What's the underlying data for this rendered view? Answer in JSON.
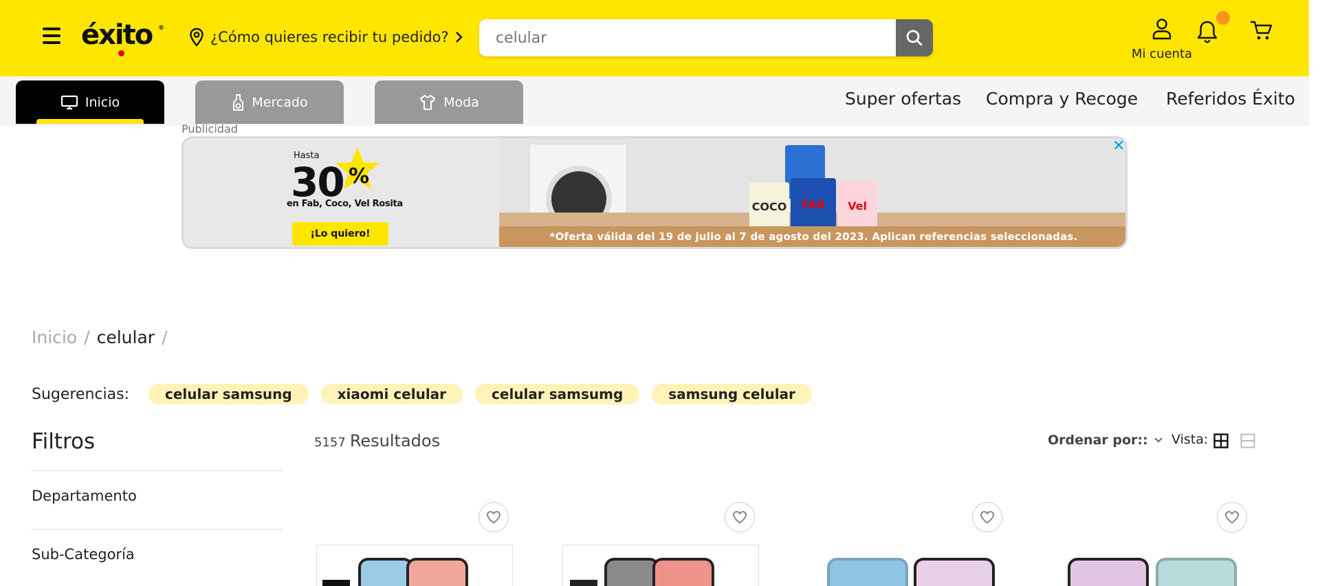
{
  "header": {
    "logo_text": "éxito",
    "logo_registered": "®",
    "location_prompt": "¿Cómo quieres recibir tu pedido?",
    "search": {
      "value": "",
      "placeholder": "celular"
    },
    "account_label": "Mi cuenta",
    "brand_color": "#ffe600"
  },
  "nav": {
    "tabs": [
      {
        "label": "Inicio",
        "icon": "monitor-icon",
        "active": true
      },
      {
        "label": "Mercado",
        "icon": "bottle-icon",
        "active": false
      },
      {
        "label": "Moda",
        "icon": "shirt-icon",
        "active": false
      }
    ],
    "links": [
      "Super ofertas",
      "Compra y Recoge",
      "Referidos Éxito"
    ]
  },
  "ad": {
    "label": "Publicidad",
    "hasta": "Hasta",
    "discount_number": "30",
    "discount_symbol": "%",
    "brands": "en Fab, Coco, Vel Rosita",
    "cta": "¡Lo quiero!",
    "legal": "*Oferta válida del 19 de julio al 7 de agosto del 2023. Aplican referencias seleccionadas.",
    "products": [
      "COCO",
      "FAB",
      "Vel"
    ],
    "close_icon": "ad-close-icon"
  },
  "breadcrumb": {
    "home": "Inicio",
    "current": "celular",
    "separator": "/"
  },
  "suggestions": {
    "label": "Sugerencias:",
    "chips": [
      "celular samsung",
      "xiaomi celular",
      "celular samsumg",
      "samsung celular"
    ]
  },
  "filters": {
    "title": "Filtros",
    "items": [
      "Departamento",
      "Sub-Categoría"
    ]
  },
  "results": {
    "count": "5157",
    "label": "Resultados",
    "sort_label": "Ordenar por::",
    "view_label": "Vista:"
  },
  "colors": {
    "header_yellow": "#ffe600",
    "notification_dot": "#f7931e",
    "chip_bg": "#fff3b8",
    "tab_active": "#000000",
    "tab_inactive": "#999999",
    "ad_close": "#00a3e0"
  }
}
